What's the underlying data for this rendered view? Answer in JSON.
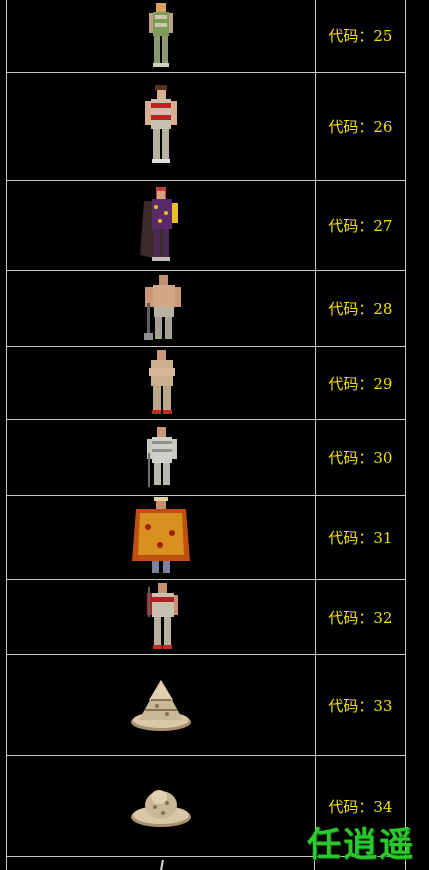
{
  "rows": [
    {
      "code_label": "代码：25",
      "sprite": "soldier-green-icon"
    },
    {
      "code_label": "代码：26",
      "sprite": "soldier-red-armor-icon"
    },
    {
      "code_label": "代码：27",
      "sprite": "general-caped-icon"
    },
    {
      "code_label": "代码：28",
      "sprite": "bare-chest-warrior-icon"
    },
    {
      "code_label": "代码：29",
      "sprite": "arms-crossed-soldier-icon"
    },
    {
      "code_label": "代码：30",
      "sprite": "staff-soldier-icon"
    },
    {
      "code_label": "代码：31",
      "sprite": "gold-cape-general-icon"
    },
    {
      "code_label": "代码：32",
      "sprite": "spear-soldier-icon"
    },
    {
      "code_label": "代码：33",
      "sprite": "pagoda-rock-icon"
    },
    {
      "code_label": "代码：34",
      "sprite": "mound-rock-icon"
    }
  ],
  "watermark": "任逍遥",
  "colors": {
    "code_text": "#f2e10a",
    "grid_line": "#c8c8c8",
    "watermark": "#2bc92b",
    "background": "#000000"
  }
}
